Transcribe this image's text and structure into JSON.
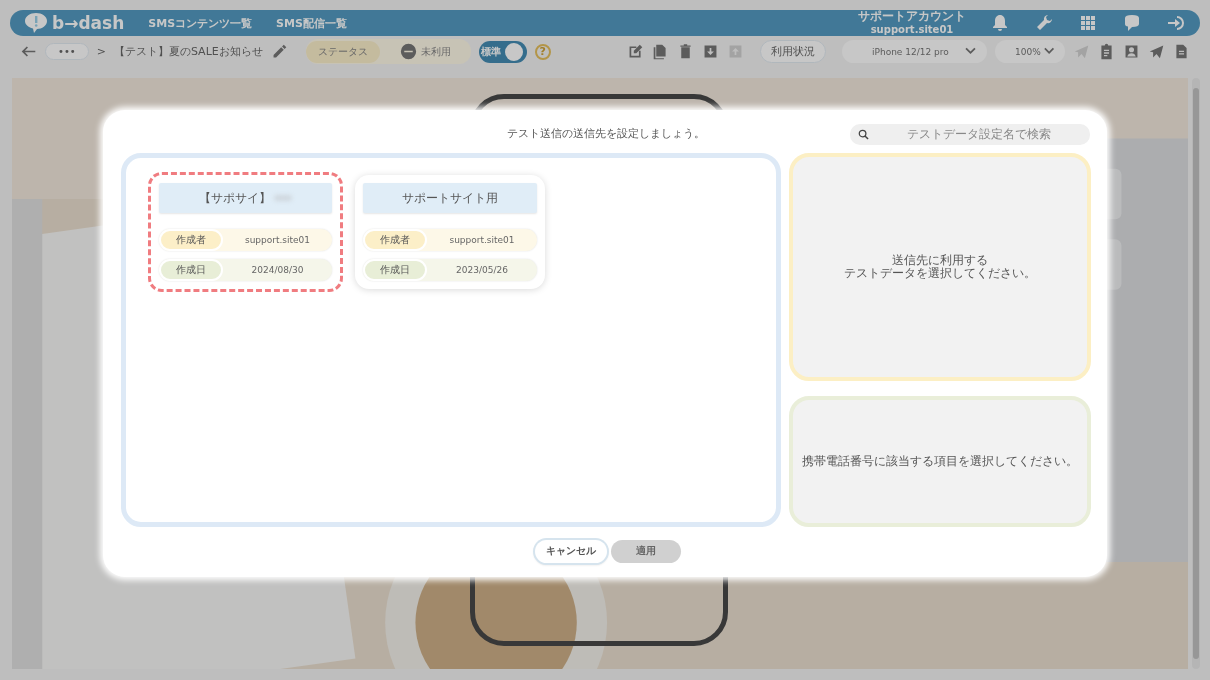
{
  "app": {
    "logo": "b→dash",
    "nav": [
      "SMSコンテンツ一覧",
      "SMS配信一覧"
    ],
    "account": {
      "name": "サポートアカウント",
      "id": "support.site01"
    }
  },
  "toolbar": {
    "more": "•••",
    "separator": ">",
    "title": "【テスト】夏のSALEお知らせ",
    "status_label": "ステータス",
    "status_value": "未利用",
    "toggle": {
      "label": "標準",
      "on": true
    },
    "help": "?",
    "usage_button": "利用状況",
    "device": "iPhone 12/12 pro",
    "zoom": "100%"
  },
  "modal": {
    "title": "テスト送信の送信先を設定しましょう。",
    "search": {
      "placeholder": "テストデータ設定名で検索"
    },
    "cards": [
      {
        "title": "【サポサイ】",
        "selected": true,
        "rows": [
          {
            "kind": "creator",
            "label": "作成者",
            "value": "support.site01"
          },
          {
            "kind": "date",
            "label": "作成日",
            "value": "2024/08/30"
          }
        ]
      },
      {
        "title": "サポートサイト用",
        "selected": false,
        "rows": [
          {
            "kind": "creator",
            "label": "作成者",
            "value": "support.site01"
          },
          {
            "kind": "date",
            "label": "作成日",
            "value": "2023/05/26"
          }
        ]
      }
    ],
    "data_hint": [
      "送信先に利用する",
      "テストデータを選択してください。"
    ],
    "phone_hint": "携帯電話番号に該当する項目を選択してください。",
    "buttons": [
      {
        "kind": "cancel",
        "label": "キャンセル",
        "disabled": false
      },
      {
        "kind": "apply",
        "label": "適用",
        "disabled": true
      }
    ]
  }
}
